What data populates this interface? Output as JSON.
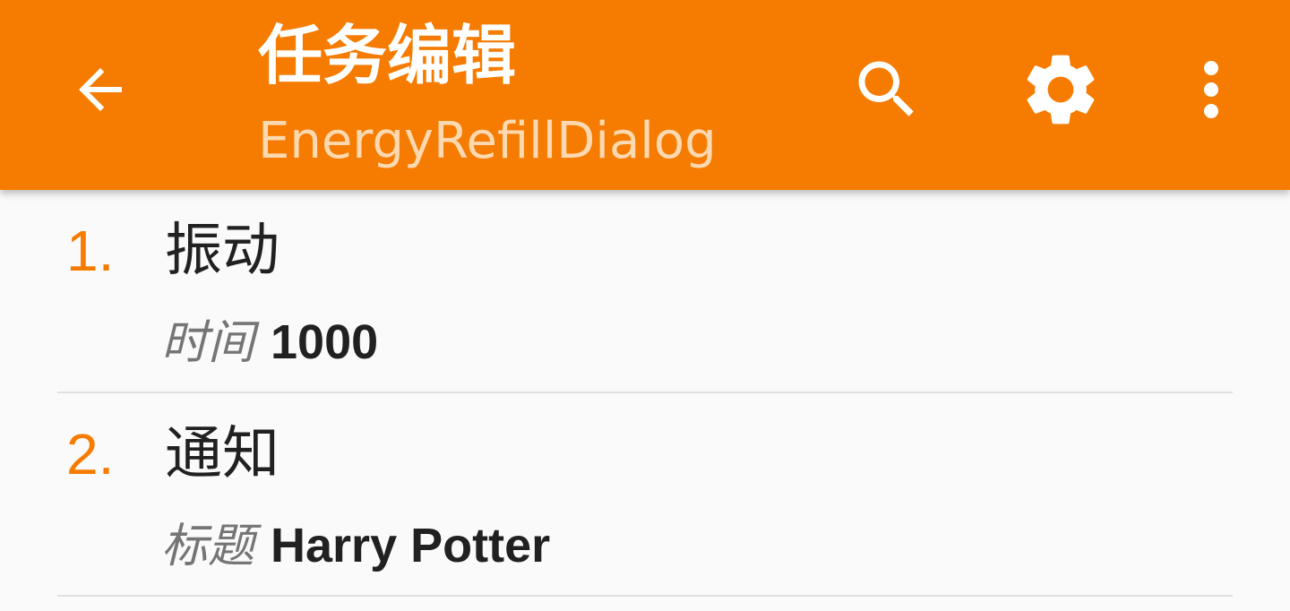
{
  "appbar": {
    "title": "任务编辑",
    "subtitle": "EnergyRefillDialog",
    "background_color": "#f57c00",
    "back_icon": "arrow-back-icon",
    "actions": [
      {
        "icon": "search-icon"
      },
      {
        "icon": "gear-icon"
      },
      {
        "icon": "more-vert-icon"
      }
    ]
  },
  "actions": [
    {
      "number": "1.",
      "name": "振动",
      "param_label": "时间",
      "param_value": "1000"
    },
    {
      "number": "2.",
      "name": "通知",
      "param_label": "标题",
      "param_value": "Harry Potter"
    }
  ]
}
